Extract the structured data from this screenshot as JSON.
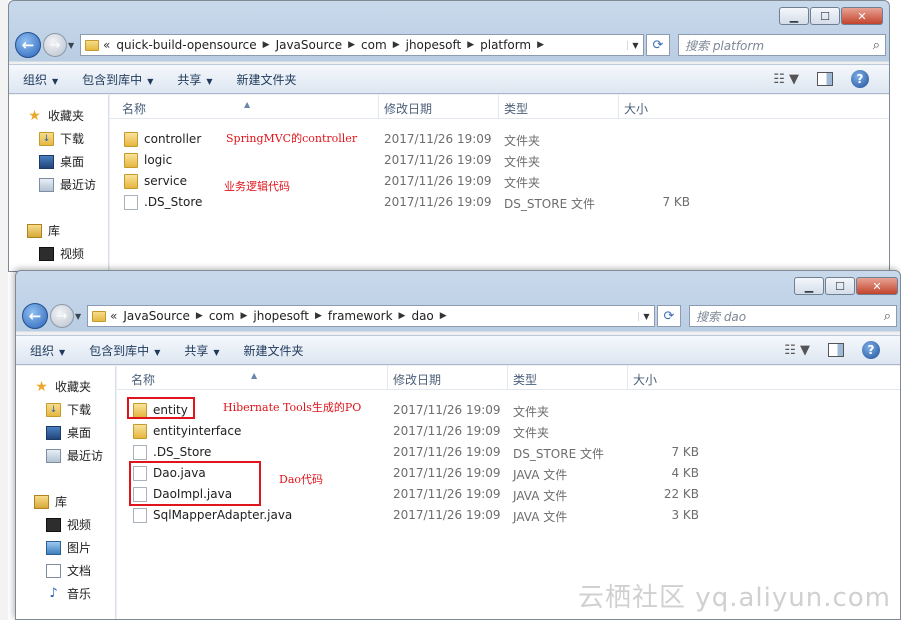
{
  "window_top": {
    "breadcrumb": [
      "quick-build-opensource",
      "JavaSource",
      "com",
      "jhopesoft",
      "platform"
    ],
    "search_placeholder": "搜索 platform",
    "toolbar": {
      "organize": "组织",
      "include_library": "包含到库中",
      "share": "共享",
      "new_folder": "新建文件夹"
    },
    "nav": {
      "favorites": "收藏夹",
      "downloads": "下载",
      "desktop": "桌面",
      "recent": "最近访",
      "libraries": "库",
      "videos": "视频"
    },
    "columns": {
      "name": "名称",
      "date": "修改日期",
      "type": "类型",
      "size": "大小"
    },
    "files": [
      {
        "name": "controller",
        "date": "2017/11/26 19:09",
        "type": "文件夹",
        "size": "",
        "icon": "folder-icon"
      },
      {
        "name": "logic",
        "date": "2017/11/26 19:09",
        "type": "文件夹",
        "size": "",
        "icon": "folder-icon"
      },
      {
        "name": "service",
        "date": "2017/11/26 19:09",
        "type": "文件夹",
        "size": "",
        "icon": "folder-icon"
      },
      {
        "name": ".DS_Store",
        "date": "2017/11/26 19:09",
        "type": "DS_STORE 文件",
        "size": "7 KB",
        "icon": "file-icon"
      }
    ],
    "annotations": {
      "controller": "SpringMVC的controller",
      "service": "业务逻辑代码"
    }
  },
  "window_bottom": {
    "breadcrumb": [
      "JavaSource",
      "com",
      "jhopesoft",
      "framework",
      "dao"
    ],
    "search_placeholder": "搜索 dao",
    "toolbar": {
      "organize": "组织",
      "include_library": "包含到库中",
      "share": "共享",
      "new_folder": "新建文件夹"
    },
    "nav": {
      "favorites": "收藏夹",
      "downloads": "下载",
      "desktop": "桌面",
      "recent": "最近访",
      "libraries": "库",
      "videos": "视频",
      "pictures": "图片",
      "documents": "文档",
      "music": "音乐"
    },
    "columns": {
      "name": "名称",
      "date": "修改日期",
      "type": "类型",
      "size": "大小"
    },
    "files": [
      {
        "name": "entity",
        "date": "2017/11/26 19:09",
        "type": "文件夹",
        "size": "",
        "icon": "folder-icon"
      },
      {
        "name": "entityinterface",
        "date": "2017/11/26 19:09",
        "type": "文件夹",
        "size": "",
        "icon": "folder-icon"
      },
      {
        "name": ".DS_Store",
        "date": "2017/11/26 19:09",
        "type": "DS_STORE 文件",
        "size": "7 KB",
        "icon": "file-icon"
      },
      {
        "name": "Dao.java",
        "date": "2017/11/26 19:09",
        "type": "JAVA 文件",
        "size": "4 KB",
        "icon": "file-icon"
      },
      {
        "name": "DaoImpl.java",
        "date": "2017/11/26 19:09",
        "type": "JAVA 文件",
        "size": "22 KB",
        "icon": "file-icon"
      },
      {
        "name": "SqlMapperAdapter.java",
        "date": "2017/11/26 19:09",
        "type": "JAVA 文件",
        "size": "3 KB",
        "icon": "file-icon"
      }
    ],
    "annotations": {
      "entity": "Hibernate Tools生成的PO",
      "dao": "Dao代码"
    }
  },
  "watermark": "云栖社区 yq.aliyun.com",
  "colors": {
    "annotation_red": "#e0141b",
    "toolbar_text": "#1e395b",
    "header_text": "#4c607a"
  }
}
